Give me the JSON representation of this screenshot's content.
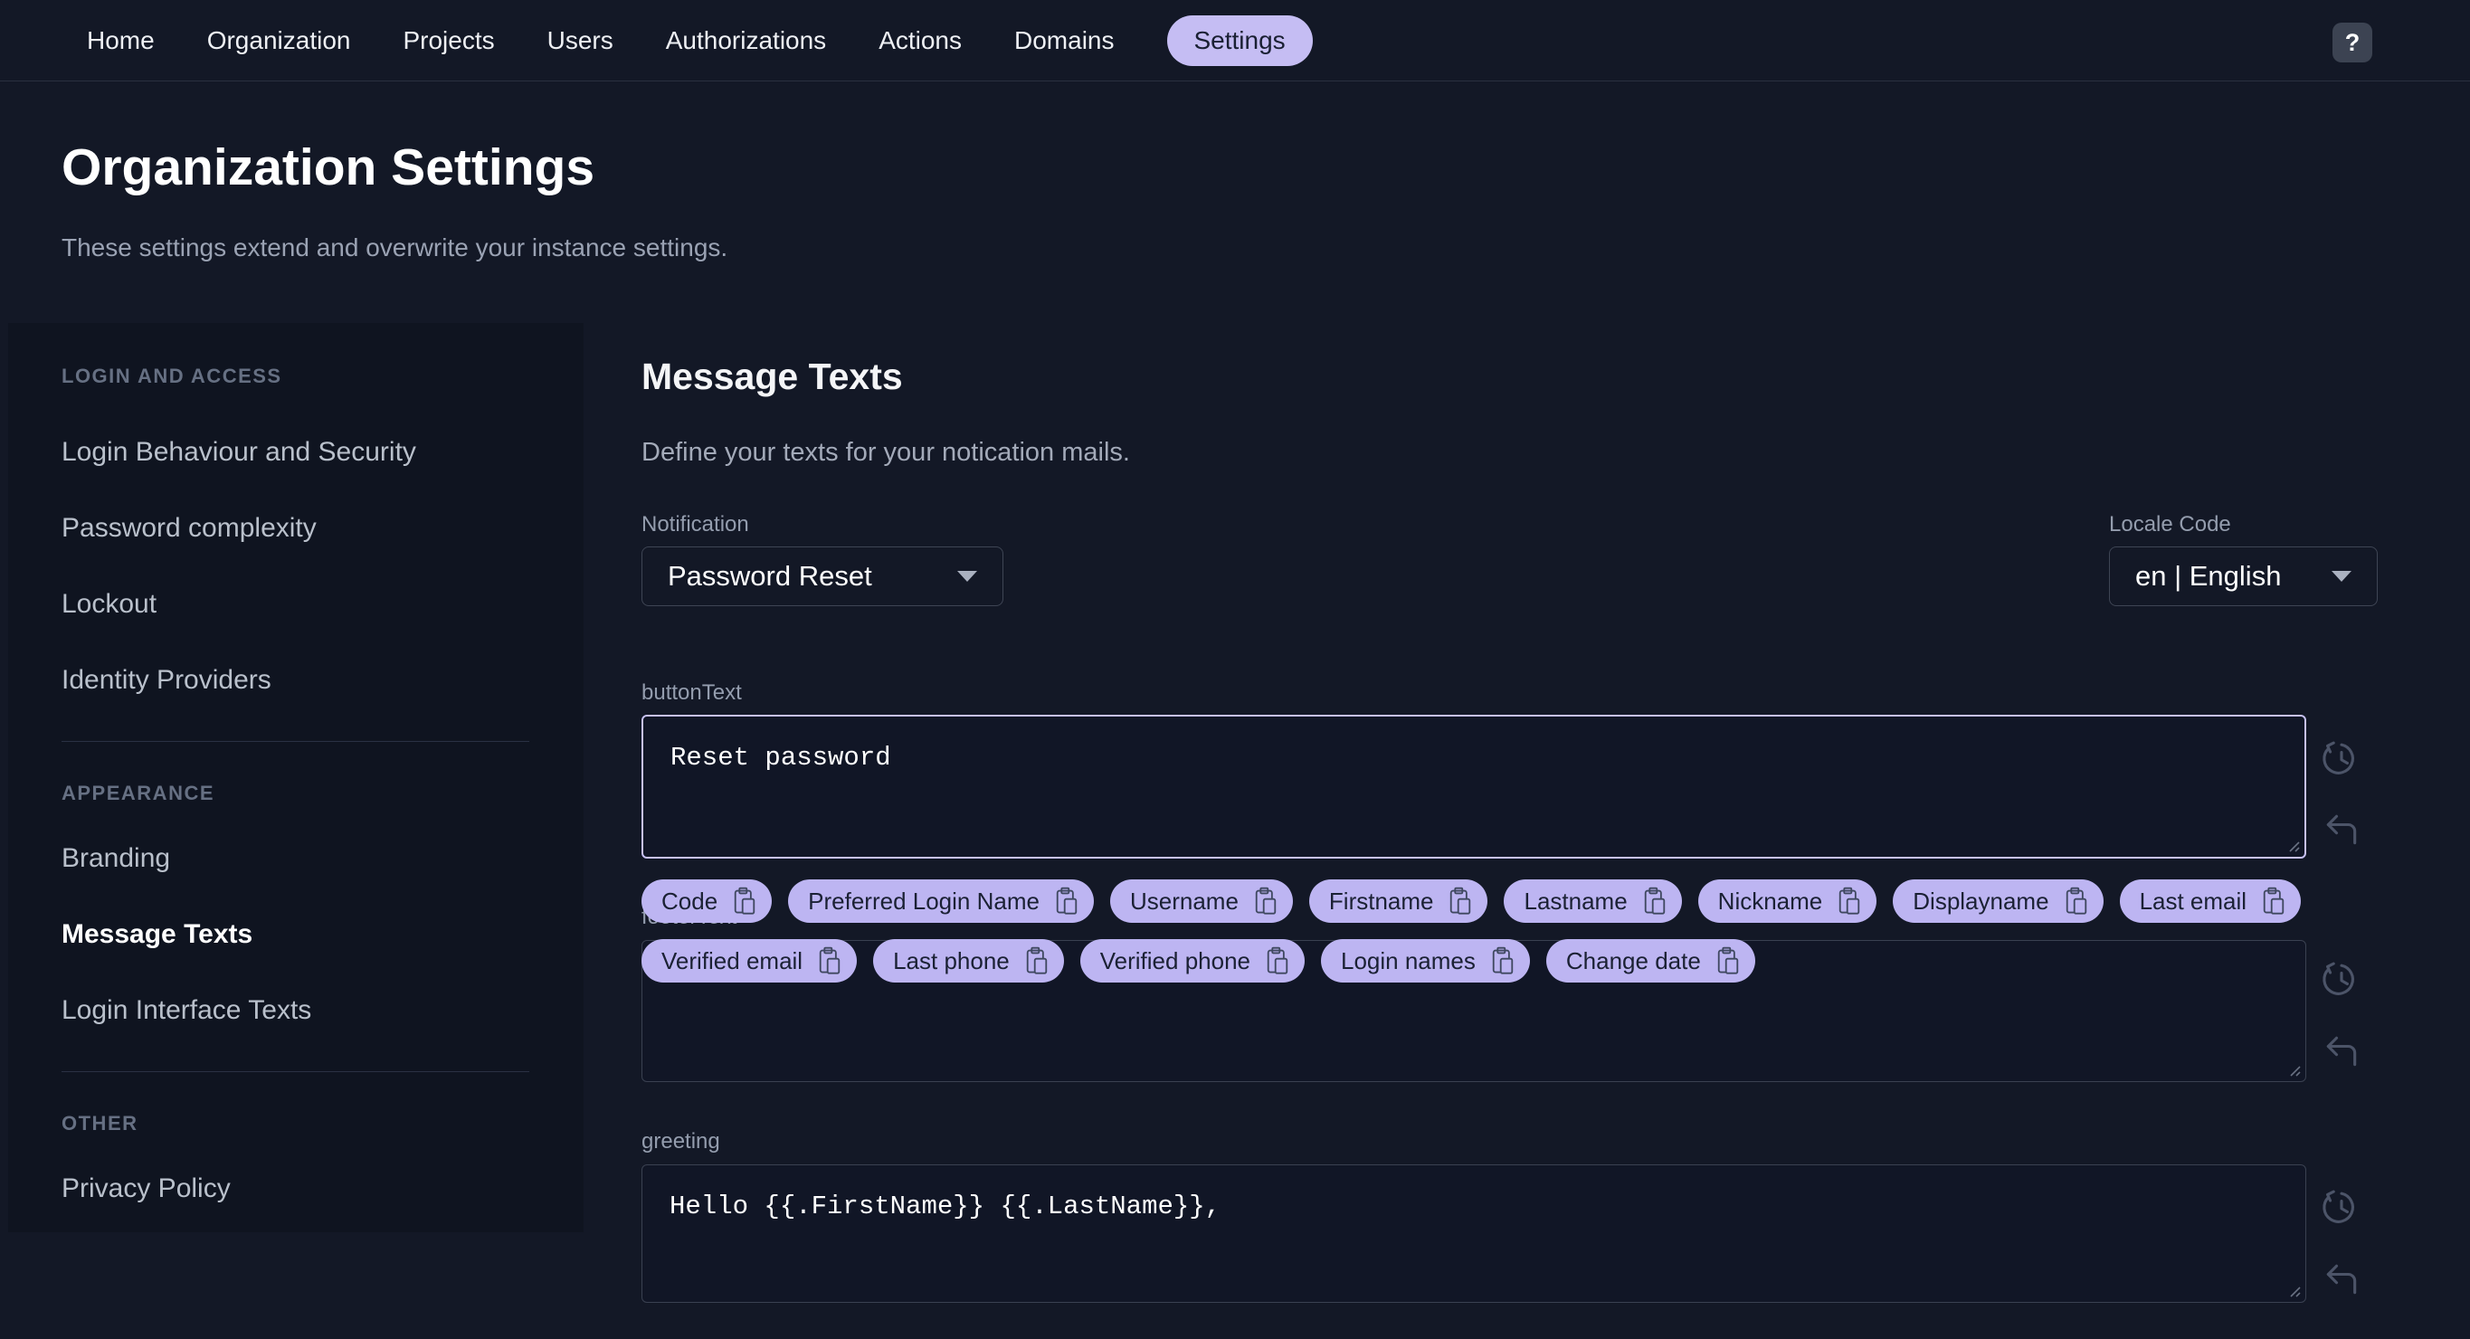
{
  "header": {
    "nav": [
      "Home",
      "Organization",
      "Projects",
      "Users",
      "Authorizations",
      "Actions",
      "Domains",
      "Settings"
    ],
    "active_nav": "Settings",
    "help_label": "?"
  },
  "page": {
    "title": "Organization Settings",
    "subtitle": "These settings extend and overwrite your instance settings."
  },
  "sidebar": {
    "active_item": "Message Texts",
    "sections": [
      {
        "title": "LOGIN AND ACCESS",
        "items": [
          "Login Behaviour and Security",
          "Password complexity",
          "Lockout",
          "Identity Providers"
        ]
      },
      {
        "title": "APPEARANCE",
        "items": [
          "Branding",
          "Message Texts",
          "Login Interface Texts"
        ]
      },
      {
        "title": "OTHER",
        "items": [
          "Privacy Policy"
        ]
      }
    ]
  },
  "main": {
    "heading": "Message Texts",
    "description": "Define your texts for your notication mails.",
    "notification": {
      "label": "Notification",
      "value": "Password Reset"
    },
    "locale": {
      "label": "Locale Code",
      "value": "en | English"
    },
    "fields": [
      {
        "label": "buttonText",
        "value": "Reset password"
      },
      {
        "label": "footerText",
        "value": ""
      },
      {
        "label": "greeting",
        "value": "Hello {{.FirstName}} {{.LastName}},"
      }
    ],
    "chips": [
      "Code",
      "Preferred Login Name",
      "Username",
      "Firstname",
      "Lastname",
      "Nickname",
      "Displayname",
      "Last email",
      "Verified email",
      "Last phone",
      "Verified phone",
      "Login names",
      "Change date"
    ],
    "icons": {
      "chip_icon": "clipboard",
      "field_action_1": "history",
      "field_action_2": "undo"
    }
  },
  "colors": {
    "accent_chip": "#bdb5f2",
    "accent_pill": "#c5bdf3",
    "focus_border": "#c7c1f5",
    "background": "#131826",
    "sidebar_background": "#0f1420"
  }
}
